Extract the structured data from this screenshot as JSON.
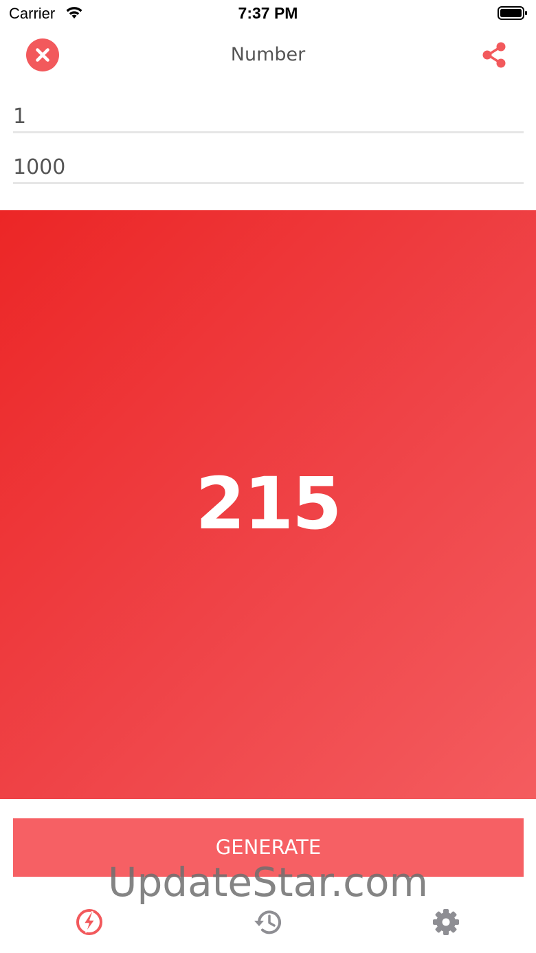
{
  "status_bar": {
    "carrier": "Carrier",
    "time": "7:37 PM",
    "icons": [
      "wifi-icon",
      "battery-icon"
    ]
  },
  "header": {
    "title": "Number",
    "close_icon": "close-icon",
    "share_icon": "share-icon"
  },
  "inputs": {
    "min_value": "1",
    "max_value": "1000"
  },
  "result": {
    "value": "215"
  },
  "actions": {
    "generate_label": "GENERATE"
  },
  "watermark": "UpdateStar.com",
  "tab_bar": {
    "items": [
      {
        "icon": "lightning-icon",
        "active": true
      },
      {
        "icon": "history-icon",
        "active": false
      },
      {
        "icon": "gear-icon",
        "active": false
      }
    ]
  },
  "colors": {
    "accent": "#f2595c",
    "gradient_start": "#ec2626",
    "gradient_end": "#f45c5f",
    "button": "#f66064",
    "inactive_icon": "#8e8e93"
  }
}
